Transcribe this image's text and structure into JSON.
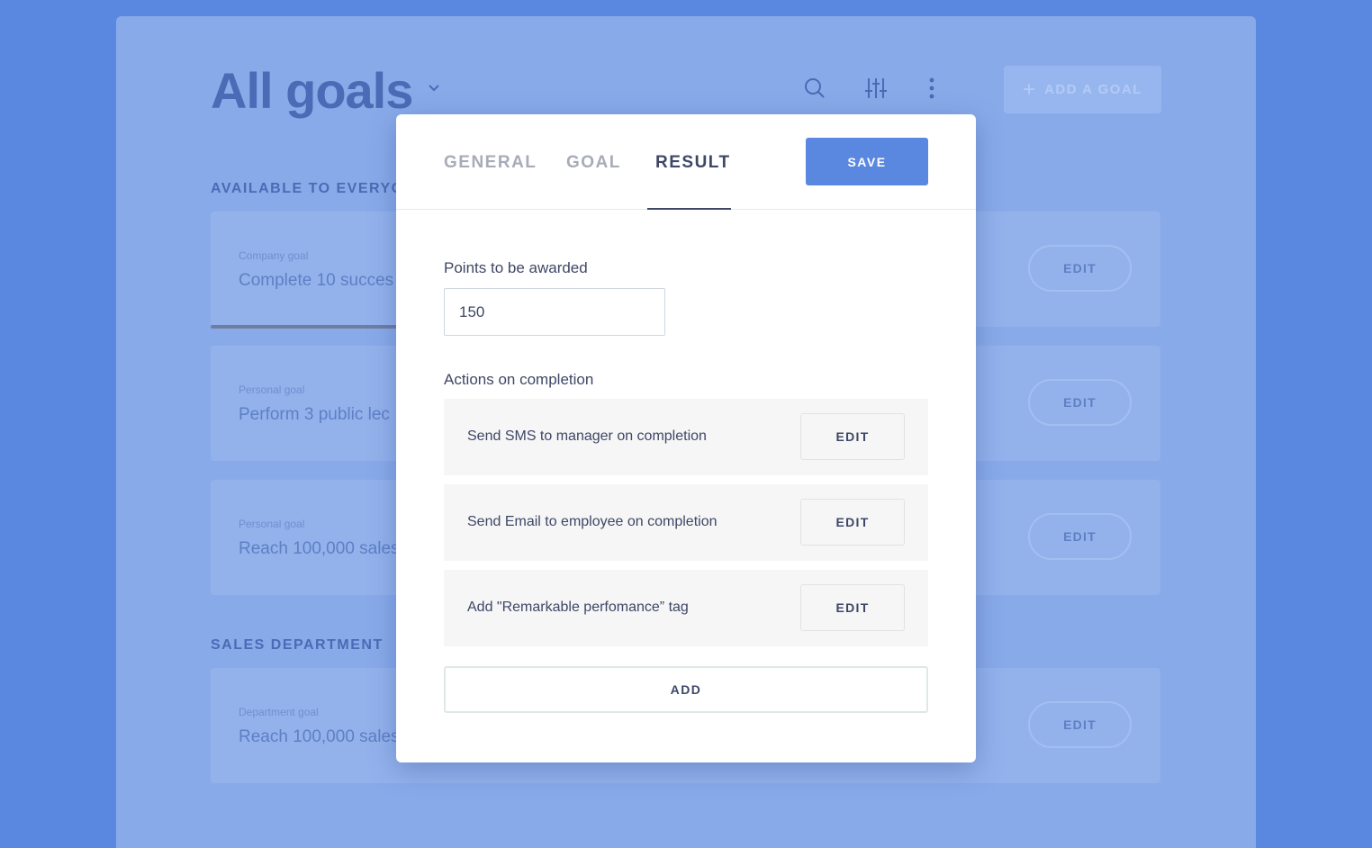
{
  "colors": {
    "outer_bg": "#5a88e0",
    "app_bg": "#89aae9",
    "accent": "#5a88e0",
    "text_dark": "#3e4766",
    "text_muted": "#a8acb8"
  },
  "background_page": {
    "title": "All goals",
    "title_chevron_icon": "chevron-down-icon",
    "toolbar_icons": [
      "search-icon",
      "filter-sliders-icon",
      "more-vertical-icon"
    ],
    "add_goal_label": "ADD A GOAL",
    "sections": [
      {
        "heading": "AVAILABLE TO EVERYO",
        "goals": [
          {
            "type": "Company goal",
            "name": "Complete 10 succes",
            "edit": "EDIT"
          },
          {
            "type": "Personal goal",
            "name": "Perform 3 public lec",
            "edit": "EDIT"
          },
          {
            "type": "Personal goal",
            "name": "Reach 100,000 sales",
            "edit": "EDIT"
          }
        ]
      },
      {
        "heading": "SALES DEPARTMENT",
        "goals": [
          {
            "type": "Department goal",
            "name": "Reach 100,000 sales",
            "edit": "EDIT"
          }
        ]
      }
    ]
  },
  "modal": {
    "tabs": [
      {
        "label": "GENERAL",
        "active": false
      },
      {
        "label": "GOAL",
        "active": false
      },
      {
        "label": "RESULT",
        "active": true
      }
    ],
    "save_label": "SAVE",
    "points_label": "Points to be awarded",
    "points_value": "150",
    "actions_label": "Actions on completion",
    "actions": [
      {
        "label": "Send SMS to manager on completion",
        "edit": "EDIT"
      },
      {
        "label": "Send Email to employee on completion",
        "edit": "EDIT"
      },
      {
        "label": "Add  \"Remarkable perfomance” tag",
        "edit": "EDIT"
      }
    ],
    "add_label": "ADD"
  }
}
